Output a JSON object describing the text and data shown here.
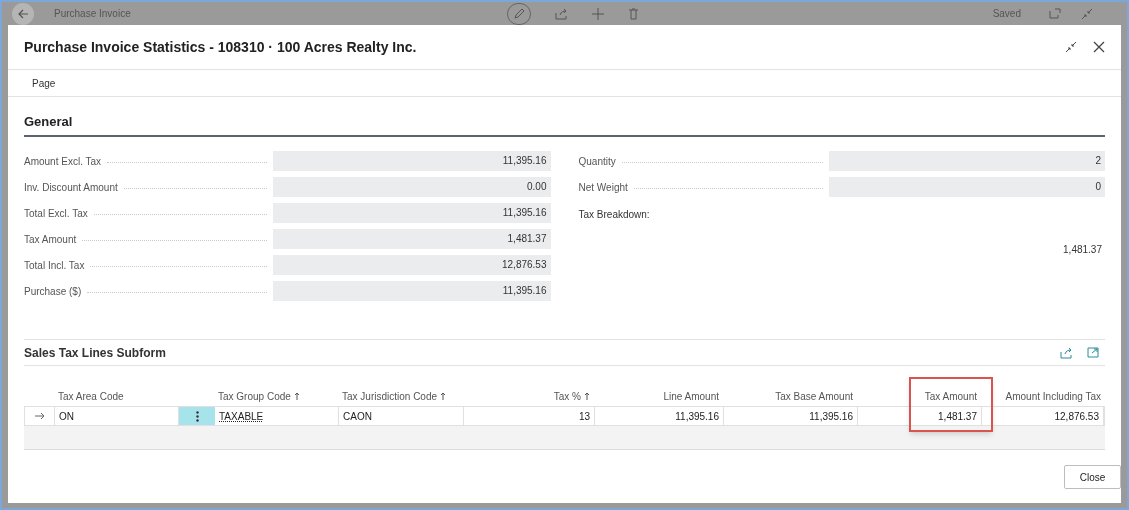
{
  "background_page": {
    "title": "Purchase Invoice",
    "status": "Saved"
  },
  "dialog": {
    "title": "Purchase Invoice Statistics - 108310 · 100 Acres Realty Inc.",
    "action_bar": [
      "Page"
    ]
  },
  "general": {
    "title": "General",
    "left_fields": [
      {
        "label": "Amount Excl. Tax",
        "value": "11,395.16"
      },
      {
        "label": "Inv. Discount Amount",
        "value": "0.00"
      },
      {
        "label": "Total Excl. Tax",
        "value": "11,395.16"
      },
      {
        "label": "Tax Amount",
        "value": "1,481.37"
      },
      {
        "label": "Total Incl. Tax",
        "value": "12,876.53"
      },
      {
        "label": "Purchase ($)",
        "value": "11,395.16"
      }
    ],
    "right_fields": [
      {
        "label": "Quantity",
        "value": "2"
      },
      {
        "label": "Net Weight",
        "value": "0"
      }
    ],
    "tax_breakdown": {
      "label": "Tax Breakdown:",
      "value": "1,481.37"
    }
  },
  "subform": {
    "title": "Sales Tax Lines Subform",
    "columns": [
      {
        "label": "Tax Area Code",
        "sorted": false
      },
      {
        "label": "Tax Group Code",
        "sorted": true
      },
      {
        "label": "Tax Jurisdiction Code",
        "sorted": true
      },
      {
        "label": "Tax %",
        "sorted": true
      },
      {
        "label": "Line Amount",
        "sorted": false
      },
      {
        "label": "Tax Base Amount",
        "sorted": false
      },
      {
        "label": "Tax Amount",
        "sorted": false,
        "highlighted": true
      },
      {
        "label": "Amount Including Tax",
        "sorted": false
      }
    ],
    "rows": [
      {
        "selected": true,
        "cells": [
          "ON",
          "TAXABLE",
          "CAON",
          "13",
          "11,395.16",
          "11,395.16",
          "1,481.37",
          "12,876.53"
        ]
      }
    ]
  },
  "buttons": [
    "Close"
  ]
}
